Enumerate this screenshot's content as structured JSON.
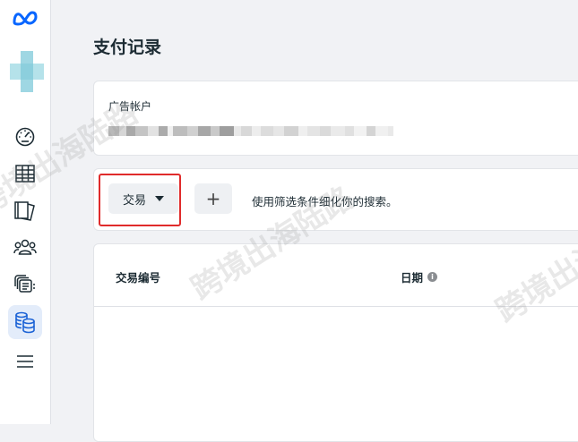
{
  "sidebar": {
    "logo_icon": "meta-logo-icon",
    "items": [
      {
        "name": "dashboard-gauge-icon"
      },
      {
        "name": "table-grid-icon"
      },
      {
        "name": "pages-stack-icon"
      },
      {
        "name": "audience-people-icon"
      },
      {
        "name": "media-library-icon"
      },
      {
        "name": "billing-database-icon",
        "active": true
      },
      {
        "name": "hamburger-menu-icon"
      }
    ]
  },
  "header": {
    "title": "支付记录"
  },
  "account": {
    "label": "广告帐户"
  },
  "filter": {
    "transaction_button": "交易",
    "add_button": "+",
    "hint": "使用筛选条件细化你的搜索。"
  },
  "table": {
    "columns": [
      "交易编号",
      "日期"
    ]
  },
  "watermark": "跨境出海陆路",
  "colors": {
    "accent": "#0866ff",
    "highlight_frame": "#e02b2b",
    "active_nav_bg": "#e3ecfa"
  }
}
